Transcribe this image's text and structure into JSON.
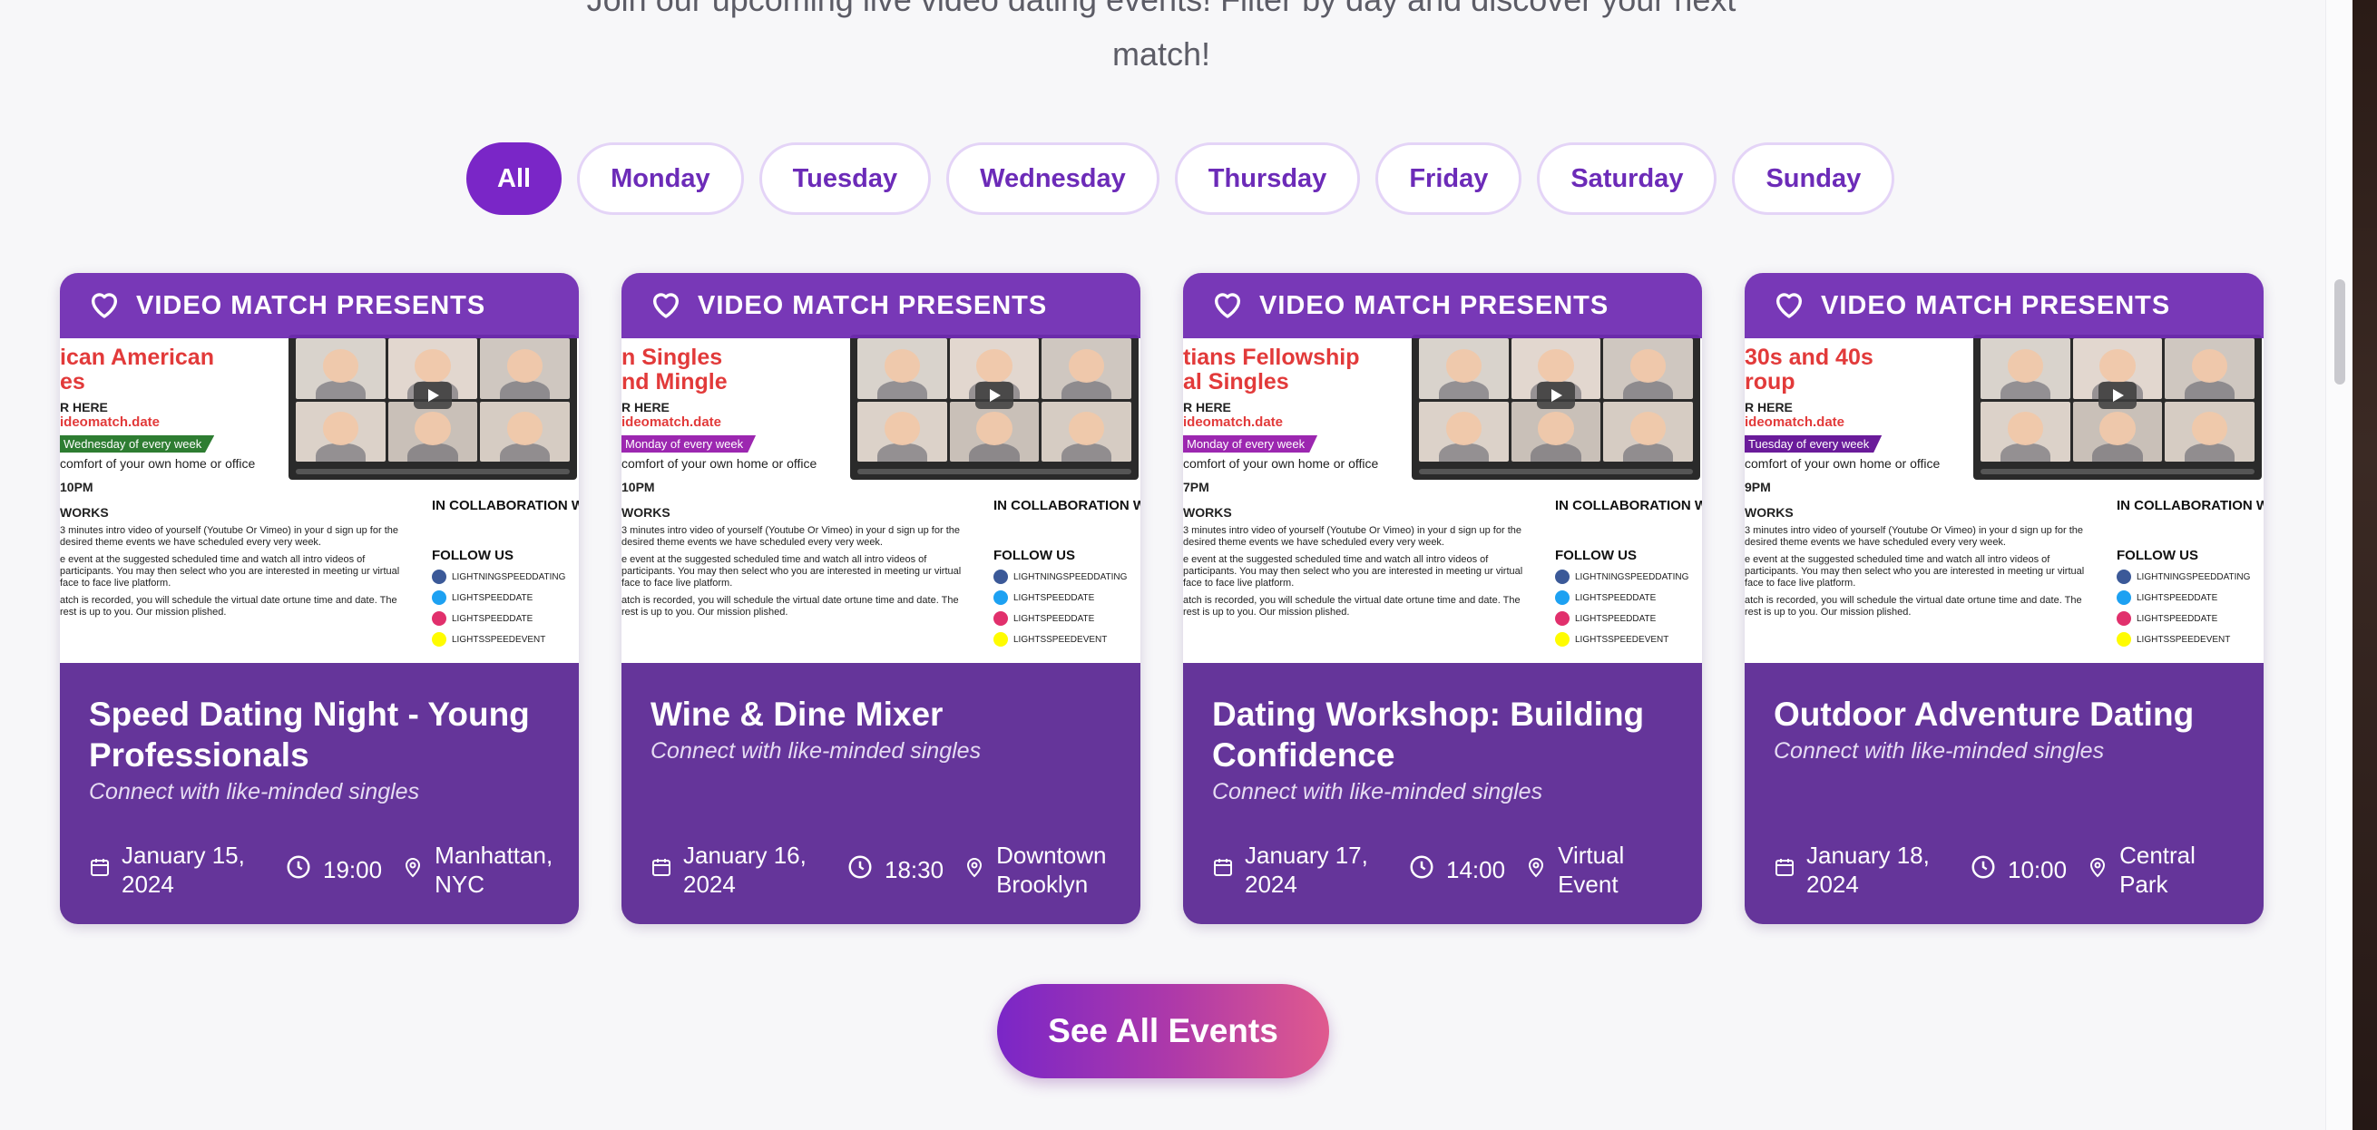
{
  "intro": {
    "line1": "Join our upcoming live video dating events! Filter by day and discover your next",
    "line2": "match!"
  },
  "filters": {
    "items": [
      {
        "label": "All",
        "active": true
      },
      {
        "label": "Monday",
        "active": false
      },
      {
        "label": "Tuesday",
        "active": false
      },
      {
        "label": "Wednesday",
        "active": false
      },
      {
        "label": "Thursday",
        "active": false
      },
      {
        "label": "Friday",
        "active": false
      },
      {
        "label": "Saturday",
        "active": false
      },
      {
        "label": "Sunday",
        "active": false
      }
    ]
  },
  "banner_text": "VIDEO MATCH PRESENTS",
  "flyer": {
    "register": "R HERE",
    "url": "ideomatch.date",
    "comfort": "comfort of your own home or office",
    "works": "WORKS",
    "para1": "3 minutes intro video of yourself (Youtube Or Vimeo) in your d sign up for the desired theme events we have scheduled every very week.",
    "para2": "e event at the suggested scheduled time and watch all intro videos of participants. You may then select who you are interested in meeting ur virtual face to face live platform.",
    "para3": "atch is recorded, you will schedule the virtual date ortune time and date. The rest is up to you. Our mission plished.",
    "collab": "IN COLLABORATION W",
    "follow": "FOLLOW US",
    "socials": [
      "LIGHTNINGSPEEDDATING",
      "LIGHTSPEEDDATE",
      "LIGHTSPEEDDATE",
      "LIGHTSSPEEDEVENT"
    ]
  },
  "cards": [
    {
      "flyer_head1": "ican American",
      "flyer_head2": "es",
      "flyer_tag": "Wednesday of every week",
      "flyer_tag_color": "#2e7d32",
      "flyer_time": "10PM",
      "title": "Speed Dating Night - Young Professionals",
      "subtitle": "Connect with like-minded singles",
      "date": "January 15, 2024",
      "time": "19:00",
      "location": "Manhattan, NYC"
    },
    {
      "flyer_head1": "n Singles",
      "flyer_head2": "nd Mingle",
      "flyer_tag": "Monday of every week",
      "flyer_tag_color": "#9c27b0",
      "flyer_time": "10PM",
      "title": "Wine & Dine Mixer",
      "subtitle": "Connect with like-minded singles",
      "date": "January 16, 2024",
      "time": "18:30",
      "location": "Downtown Brooklyn"
    },
    {
      "flyer_head1": "tians Fellowship",
      "flyer_head2": "al Singles",
      "flyer_tag": "Monday of every week",
      "flyer_tag_color": "#9c27b0",
      "flyer_time": "7PM",
      "title": "Dating Workshop: Building Confidence",
      "subtitle": "Connect with like-minded singles",
      "date": "January 17, 2024",
      "time": "14:00",
      "location": "Virtual Event"
    },
    {
      "flyer_head1": "30s and 40s",
      "flyer_head2": "roup",
      "flyer_tag": "Tuesday of every week",
      "flyer_tag_color": "#6a1b9a",
      "flyer_time": "9PM",
      "title": "Outdoor Adventure Dating",
      "subtitle": "Connect with like-minded singles",
      "date": "January 18, 2024",
      "time": "10:00",
      "location": "Central Park"
    }
  ],
  "see_all_label": "See All Events",
  "colors": {
    "accent": "#7a26c7",
    "card_bg": "#65359a",
    "chip_border": "#e4d4f7"
  }
}
